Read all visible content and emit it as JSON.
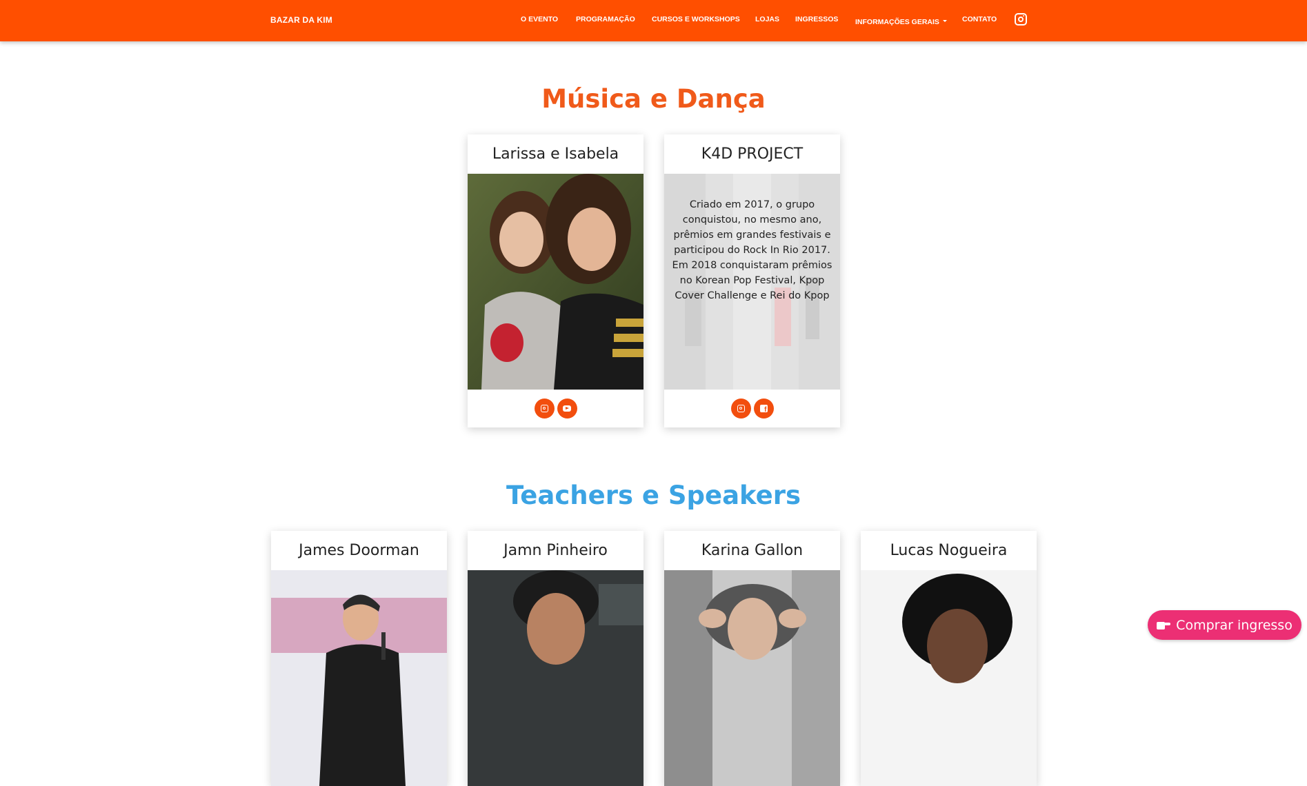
{
  "navbar": {
    "brand": "BAZAR DA KIM",
    "items": [
      {
        "label": "O EVENTO"
      },
      {
        "label": "PROGRAMAÇÃO"
      },
      {
        "label": "CURSOS E WORKSHOPS"
      },
      {
        "label": "LOJAS"
      },
      {
        "label": "INGRESSOS"
      },
      {
        "label": "INFORMAÇÕES GERAIS"
      },
      {
        "label": "CONTATO"
      }
    ],
    "instagram_icon": "instagram-icon",
    "color": "#ff4f00"
  },
  "music_section": {
    "title": "Música e Dança",
    "cards": [
      {
        "name": "Larissa e Isabela",
        "social": [
          "instagram-icon",
          "youtube-icon"
        ]
      },
      {
        "name": "K4D PROJECT",
        "description": "Criado em 2017, o grupo conquistou, no mesmo ano, prêmios em grandes festivais e participou do Rock In Rio 2017. Em 2018 conquistaram prêmios no Korean Pop Festival, Kpop Cover Challenge e Rei do Kpop",
        "social": [
          "instagram-icon",
          "facebook-icon"
        ]
      }
    ]
  },
  "teachers_section": {
    "title": "Teachers e Speakers",
    "cards": [
      {
        "name": "James Doorman"
      },
      {
        "name": "Jamn Pinheiro"
      },
      {
        "name": "Karina Gallon"
      },
      {
        "name": "Lucas Nogueira"
      }
    ]
  },
  "fab": {
    "label": "Comprar ingresso",
    "icon": "hand-pointer-icon",
    "color": "#ec2f74"
  }
}
